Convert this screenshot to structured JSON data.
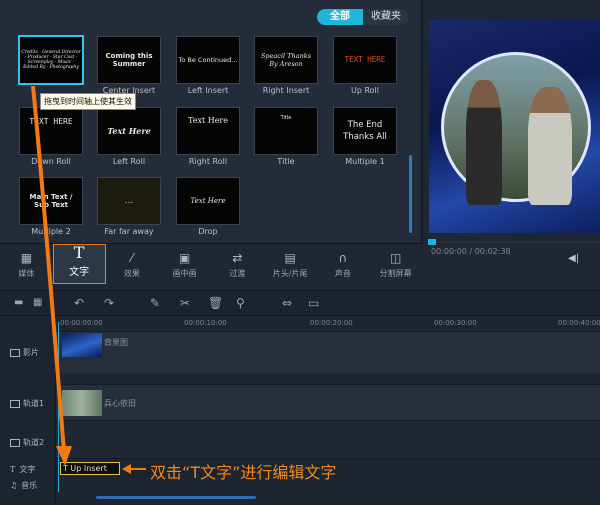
{
  "library": {
    "tabs": [
      "全部",
      "收藏夹"
    ],
    "tooltip": "拖曳到时间轴上使其生效",
    "tiles": [
      {
        "label": "",
        "preview": "Credits · General Director · Producer · Star Cast · Screenplay · Music · Edited By · Photography"
      },
      {
        "label": "Center Insert",
        "preview": "Coming this Summer"
      },
      {
        "label": "Left Insert",
        "preview": "To Be Continued..."
      },
      {
        "label": "Right Insert",
        "preview": "Speacil Thanks By Areson"
      },
      {
        "label": "Up Roll",
        "preview": "TEXT HERE"
      },
      {
        "label": "Down Roll",
        "preview": "TEXT HERE"
      },
      {
        "label": "Left Roll",
        "preview": "Text Here"
      },
      {
        "label": "Right Roll",
        "preview": "Text Here"
      },
      {
        "label": "Title",
        "preview": "Title"
      },
      {
        "label": "Multiple 1",
        "preview": "The End Thanks All"
      },
      {
        "label": "Multiple 2",
        "preview": "Main Text / Sub Text"
      },
      {
        "label": "Far far away",
        "preview": "..."
      },
      {
        "label": "Drop",
        "preview": "Text Here"
      }
    ]
  },
  "categories": [
    {
      "label": "媒体",
      "icon": "film-icon"
    },
    {
      "label": "文字",
      "icon": "text-t-icon",
      "glyph": "T"
    },
    {
      "label": "效果",
      "icon": "magic-wand-icon"
    },
    {
      "label": "画中画",
      "icon": "pip-icon"
    },
    {
      "label": "过渡",
      "icon": "transition-icon"
    },
    {
      "label": "片头/片尾",
      "icon": "clapper-icon"
    },
    {
      "label": "声音",
      "icon": "headphones-icon"
    },
    {
      "label": "分割屏幕",
      "icon": "split-screen-icon"
    }
  ],
  "preview": {
    "timecode": "00:00:00 / 00:02:38"
  },
  "timeline": {
    "ruler_ticks": [
      "00:00:00:00",
      "00:00:10:00",
      "00:00:20:00",
      "00:00:30:00",
      "00:00:40:00"
    ],
    "tracks": [
      {
        "label": "影片",
        "clip": "背景图"
      },
      {
        "label": "轨道1",
        "clip": "兵心依旧"
      },
      {
        "label": "轨道2",
        "clip": ""
      },
      {
        "label": "文字",
        "clip": "T Up Insert"
      },
      {
        "label": "音乐",
        "clip": ""
      }
    ]
  },
  "annotation": "双击“T文字”进行编辑文字",
  "colors": {
    "accent": "#1fb6d9",
    "highlight": "#f07b1a",
    "annotation": "#f48a1e"
  }
}
